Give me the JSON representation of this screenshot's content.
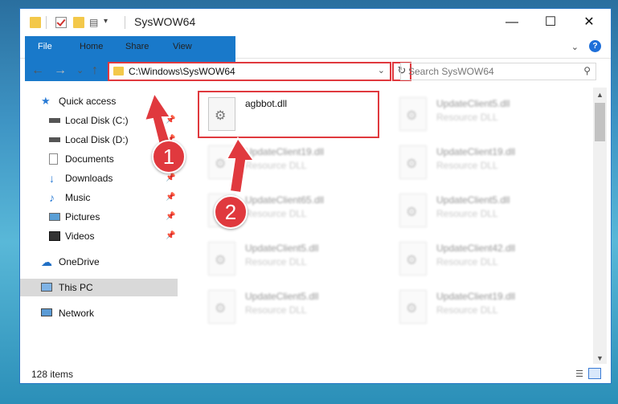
{
  "window": {
    "title": "SysWOW64",
    "controls": {
      "minimize": "—",
      "maximize": "☐",
      "close": "✕"
    }
  },
  "ribbon": {
    "tabs": [
      "File",
      "Home",
      "Share",
      "View"
    ],
    "help": "?"
  },
  "nav": {
    "back": "←",
    "forward": "→",
    "recent": "⌄",
    "up": "↑",
    "address": "C:\\Windows\\SysWOW64",
    "refresh": "↻",
    "search_placeholder": "Search SysWOW64"
  },
  "sidebar": {
    "items": [
      {
        "label": "Quick access",
        "icon": "star-icon",
        "pinned": false
      },
      {
        "label": "Local Disk (C:)",
        "icon": "drive-icon",
        "pinned": true
      },
      {
        "label": "Local Disk (D:)",
        "icon": "drive-icon",
        "pinned": true
      },
      {
        "label": "Documents",
        "icon": "documents-icon",
        "pinned": true
      },
      {
        "label": "Downloads",
        "icon": "download-icon",
        "pinned": true
      },
      {
        "label": "Music",
        "icon": "music-icon",
        "pinned": true
      },
      {
        "label": "Pictures",
        "icon": "pictures-icon",
        "pinned": true
      },
      {
        "label": "Videos",
        "icon": "videos-icon",
        "pinned": true
      },
      {
        "label": "OneDrive",
        "icon": "cloud-icon",
        "pinned": false
      },
      {
        "label": "This PC",
        "icon": "pc-icon",
        "pinned": false,
        "selected": true
      },
      {
        "label": "Network",
        "icon": "network-icon",
        "pinned": false
      }
    ]
  },
  "files": [
    {
      "name": "agbbot.dll",
      "type": "",
      "blurred": false
    },
    {
      "name": "UpdateClient5.dll",
      "type": "Resource DLL",
      "blurred": true
    },
    {
      "name": "UpdateClient19.dll",
      "type": "Resource DLL",
      "blurred": true
    },
    {
      "name": "UpdateClient19.dll",
      "type": "Resource DLL",
      "blurred": true
    },
    {
      "name": "UpdateClient65.dll",
      "type": "Resource DLL",
      "blurred": true
    },
    {
      "name": "UpdateClient5.dll",
      "type": "Resource DLL",
      "blurred": true
    },
    {
      "name": "UpdateClient5.dll",
      "type": "Resource DLL",
      "blurred": true
    },
    {
      "name": "UpdateClient42.dll",
      "type": "Resource DLL",
      "blurred": true
    },
    {
      "name": "UpdateClient5.dll",
      "type": "Resource DLL",
      "blurred": true
    },
    {
      "name": "UpdateClient19.dll",
      "type": "Resource DLL",
      "blurred": true
    }
  ],
  "status": {
    "count": "128 items"
  },
  "annotations": {
    "step1": "1",
    "step2": "2",
    "color": "#e0393e"
  }
}
